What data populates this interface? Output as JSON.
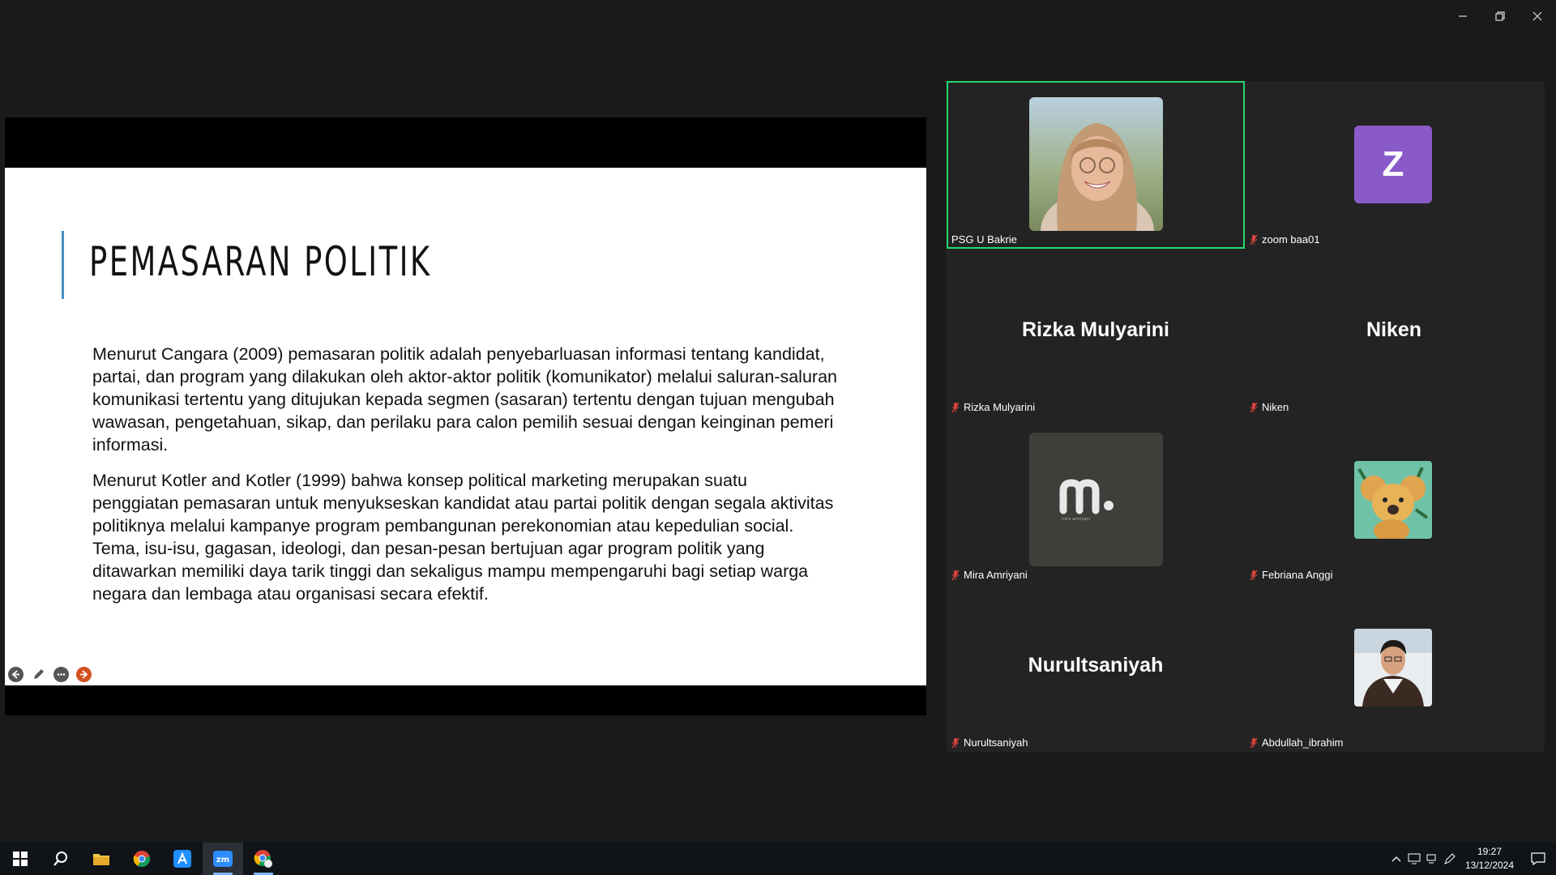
{
  "slide": {
    "title": "PEMASARAN POLITIK",
    "paragraph1": "Menurut Cangara (2009) pemasaran politik adalah penyebarluasan informasi tentang kandidat, partai, dan program yang dilakukan oleh aktor-aktor politik (komunikator) melalui saluran-saluran komunikasi tertentu yang ditujukan kepada segmen (sasaran) tertentu dengan tujuan mengubah wawasan, pengetahuan, sikap, dan perilaku para calon pemilih sesuai dengan keinginan pemeri informasi.",
    "paragraph2": "Menurut Kotler and Kotler (1999) bahwa konsep political marketing merupakan suatu penggiatan pemasaran untuk menyukseskan kandidat atau partai politik dengan segala aktivitas politiknya melalui kampanye program pembangunan perekonomian atau kepedulian social. Tema, isu-isu, gagasan, ideologi, dan pesan-pesan bertujuan agar program politik yang ditawarkan memiliki daya tarik tinggi dan sekaligus mampu mempengaruhi bagi setiap warga negara dan lembaga atau organisasi secara efektif."
  },
  "participants": [
    {
      "name": "PSG U Bakrie",
      "muted": false,
      "active": true,
      "display": "photo"
    },
    {
      "name": "zoom baa01",
      "muted": true,
      "display": "initial",
      "initial": "Z"
    },
    {
      "name": "Rizka Mulyarini",
      "muted": true,
      "display": "name",
      "big_name": "Rizka Mulyarini"
    },
    {
      "name": "Niken",
      "muted": true,
      "display": "name",
      "big_name": "Niken"
    },
    {
      "name": "Mira Amriyani",
      "muted": true,
      "display": "logo"
    },
    {
      "name": "Febriana Anggi",
      "muted": true,
      "display": "koala"
    },
    {
      "name": "Nurultsaniyah",
      "muted": true,
      "display": "name",
      "big_name": "Nurultsaniyah"
    },
    {
      "name": "Abdullah_ibrahim",
      "muted": true,
      "display": "photo-small"
    }
  ],
  "taskbar": {
    "apps": [
      "start-icon",
      "search-icon",
      "file-explorer-icon",
      "chrome-icon",
      "app-store-icon",
      "zoom-icon",
      "chrome-profile-icon"
    ],
    "time": "19:27",
    "date": "13/12/2024"
  },
  "colors": {
    "active_speaker_border": "#23d96e",
    "avatar_z": "#8a5ac9",
    "muted_mic": "#e0443e"
  }
}
